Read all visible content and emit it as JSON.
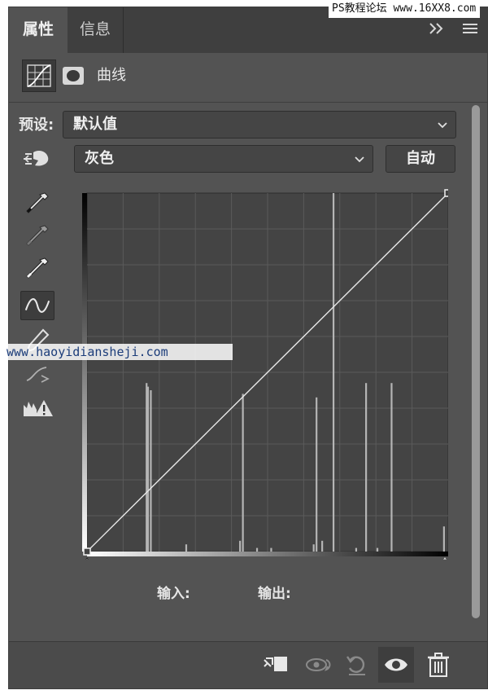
{
  "tabs": [
    {
      "label": "属性",
      "active": true
    },
    {
      "label": "信息",
      "active": false
    }
  ],
  "watermark_top": "PS教程论坛 www.16XX8.com",
  "watermark_mid": "www.haoyidiansheji.com",
  "adjustment": {
    "type_label": "曲线",
    "icons": [
      "curves-adjustment-icon",
      "layer-mask-icon"
    ]
  },
  "preset": {
    "label": "预设:",
    "value": "默认值"
  },
  "channel": {
    "value": "灰色"
  },
  "auto_button": "自动",
  "tools": [
    "on-image-adjust-icon",
    "black-point-eyedropper-icon",
    "gray-point-eyedropper-icon",
    "white-point-eyedropper-icon",
    "curve-points-icon",
    "pencil-draw-icon",
    "smooth-curve-icon",
    "clipping-warning-icon"
  ],
  "io": {
    "input_label": "输入:",
    "output_label": "输出:"
  },
  "histogram": {
    "bins_description": "levels 0-255, relative height 0-1",
    "bars": [
      {
        "level": 42,
        "height": 0.47
      },
      {
        "level": 43,
        "height": 0.46
      },
      {
        "level": 45,
        "height": 0.45
      },
      {
        "level": 110,
        "height": 0.44
      },
      {
        "level": 162,
        "height": 0.43
      },
      {
        "level": 174,
        "height": 1.0
      },
      {
        "level": 197,
        "height": 0.47
      },
      {
        "level": 215,
        "height": 0.47
      },
      {
        "level": 70,
        "height": 0.02
      },
      {
        "level": 108,
        "height": 0.03
      },
      {
        "level": 120,
        "height": 0.01
      },
      {
        "level": 130,
        "height": 0.01
      },
      {
        "level": 160,
        "height": 0.02
      },
      {
        "level": 166,
        "height": 0.03
      },
      {
        "level": 190,
        "height": 0.01
      },
      {
        "level": 205,
        "height": 0.01
      },
      {
        "level": 252,
        "height": 0.07
      }
    ]
  },
  "curve_points": [
    [
      0,
      0
    ],
    [
      255,
      255
    ]
  ],
  "footer_icons": [
    "clip-to-layer-icon",
    "view-previous-state-icon",
    "reset-icon",
    "visibility-eye-icon",
    "delete-trash-icon"
  ],
  "colors": {
    "panel_bg": "#535353",
    "tab_bar": "#3f3f3f",
    "graph_bg": "#444444",
    "grid": "#5a5a5a",
    "curve": "#e8e8e8"
  }
}
